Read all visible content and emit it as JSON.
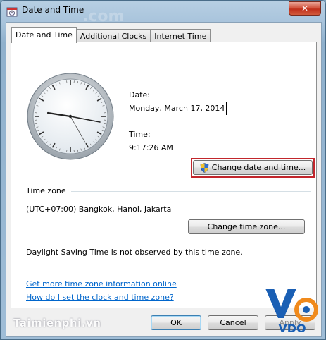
{
  "window": {
    "title": "Date and Time",
    "close_glyph": "✕"
  },
  "tabs": [
    {
      "label": "Date and Time",
      "active": true
    },
    {
      "label": "Additional Clocks",
      "active": false
    },
    {
      "label": "Internet Time",
      "active": false
    }
  ],
  "date": {
    "label": "Date:",
    "value": "Monday, March 17, 2014"
  },
  "time": {
    "label": "Time:",
    "value": "9:17:26 AM"
  },
  "change_datetime_button": "Change date and time...",
  "timezone": {
    "heading": "Time zone",
    "value": "(UTC+07:00) Bangkok, Hanoi, Jakarta",
    "change_button": "Change time zone...",
    "dst_note": "Daylight Saving Time is not observed by this time zone."
  },
  "links": [
    "Get more time zone information online",
    "How do I set the clock and time zone?"
  ],
  "buttons": {
    "ok": "OK",
    "cancel": "Cancel",
    "apply": "Apply"
  },
  "watermarks": {
    "site": "Taimienphi.vn",
    "brand": "VDO"
  },
  "colors": {
    "highlight": "#c2262c",
    "link": "#0066cc",
    "brand_blue": "#1a5fb4",
    "brand_orange": "#f08a1c"
  },
  "icons": {
    "window": "clock-calendar-icon",
    "uac": "uac-shield-icon",
    "close": "close-icon"
  }
}
